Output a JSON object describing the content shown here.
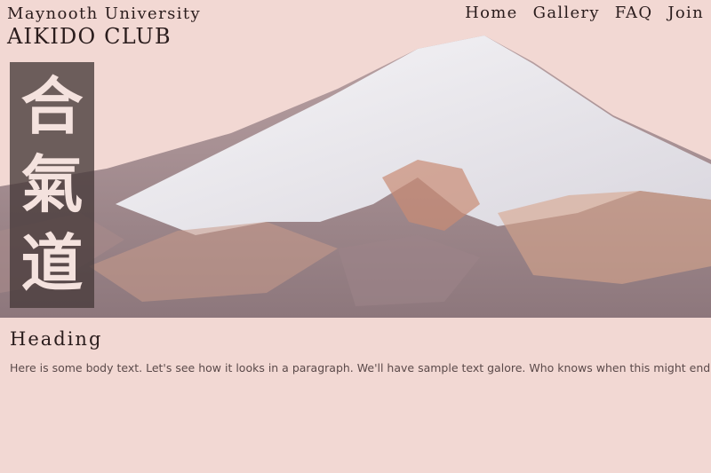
{
  "header": {
    "brand_line1": "Maynooth University",
    "brand_line2": "AIKIDO CLUB"
  },
  "nav": {
    "items": [
      "Home",
      "Gallery",
      "FAQ",
      "Join"
    ]
  },
  "hero": {
    "kanji": [
      "合",
      "氣",
      "道"
    ]
  },
  "content": {
    "heading": "Heading",
    "body": "Here is some body text.  Let's see how it looks in a paragraph.  We'll have sample text galore.  Who knows when this might end?"
  },
  "colors": {
    "background": "#f2d8d3",
    "text": "#2a1c1c",
    "banner": "#463a3a"
  }
}
